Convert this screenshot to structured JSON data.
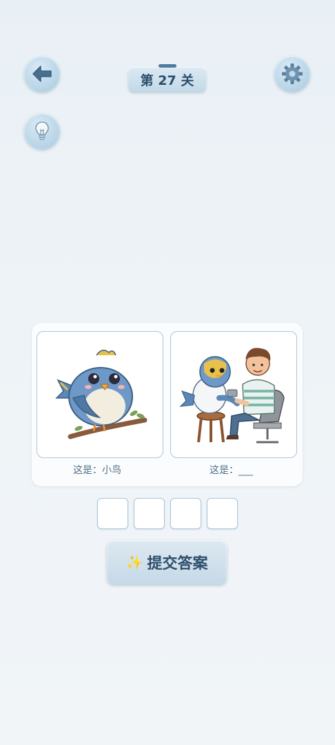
{
  "header": {
    "level_label": "第 27 关"
  },
  "icons": {
    "back": "arrow-left-icon",
    "settings": "gear-icon",
    "hint": "lightbulb-icon",
    "submit": "sparkle-icon"
  },
  "puzzle": {
    "captions": [
      "这是：小鸟",
      "这是：___"
    ],
    "answer_slots": [
      "",
      "",
      "",
      ""
    ]
  },
  "actions": {
    "submit_label": "提交答案"
  },
  "colors": {
    "accent": "#2e4f6b",
    "button_blue": "#b6d3e6",
    "border_blue": "#a9c6da"
  }
}
